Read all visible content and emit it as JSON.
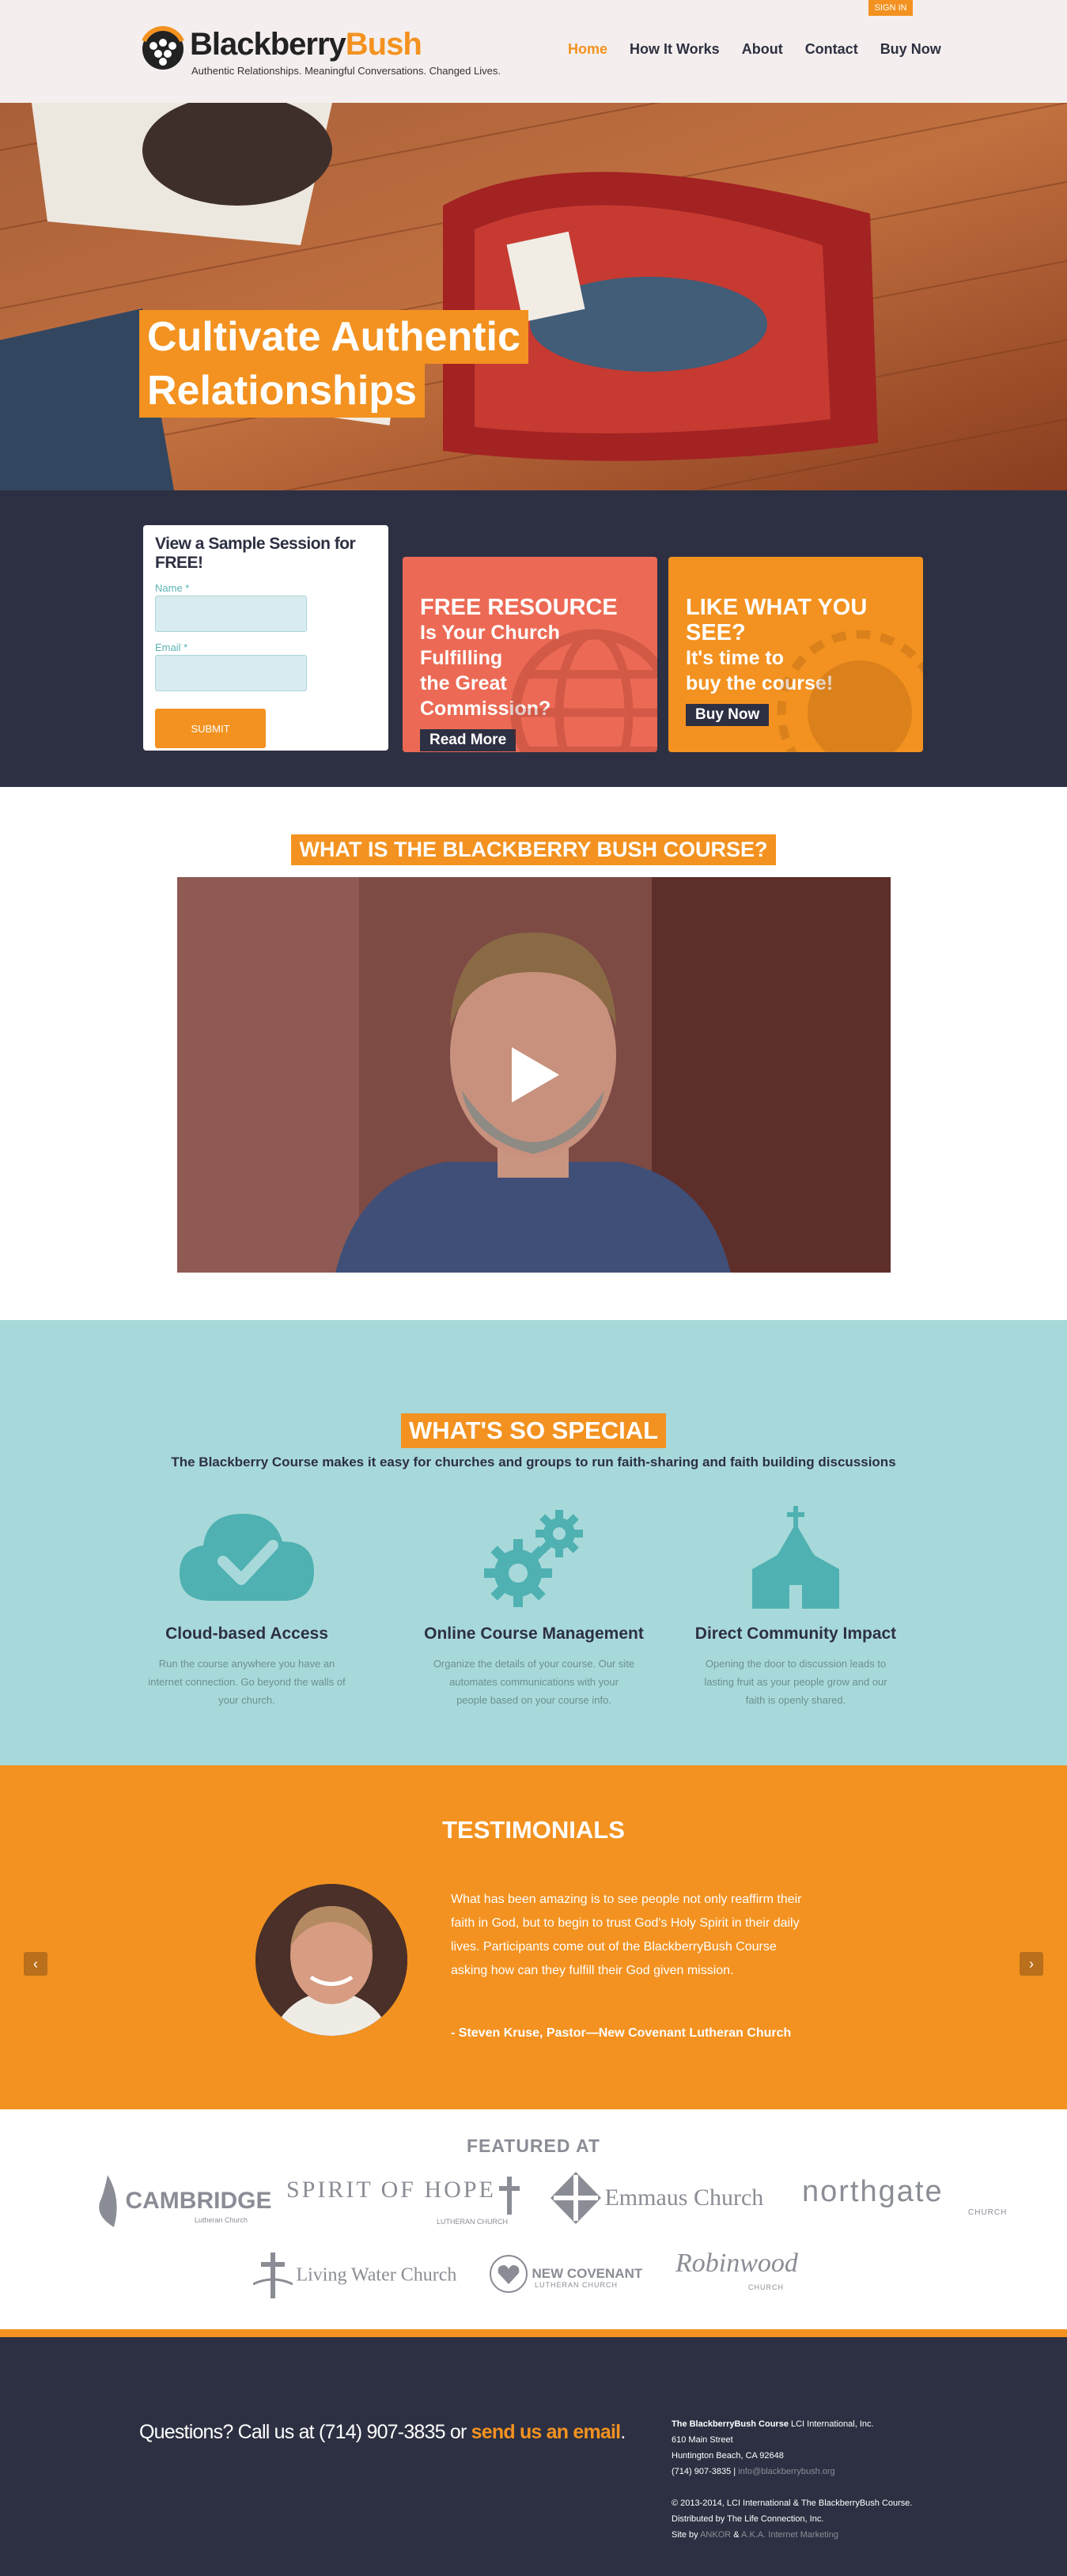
{
  "header": {
    "signin_label": "SIGN IN",
    "brand_part1": "Blackberry",
    "brand_part2": "Bush",
    "tagline": "Authentic Relationships. Meaningful Conversations. Changed Lives.",
    "nav": [
      {
        "label": "Home",
        "active": true
      },
      {
        "label": "How It Works",
        "active": false
      },
      {
        "label": "About",
        "active": false
      },
      {
        "label": "Contact",
        "active": false
      },
      {
        "label": "Buy Now",
        "active": false
      }
    ]
  },
  "hero": {
    "line1": "Cultivate Authentic",
    "line2": "Relationships"
  },
  "signup": {
    "title": "View a Sample Session for FREE!",
    "name_label": "Name *",
    "email_label": "Email *",
    "submit_label": "SUBMIT"
  },
  "promo_resource": {
    "heading": "FREE RESOURCE",
    "line1": "Is Your Church Fulfilling",
    "line2": "the Great Commission?",
    "button": "Read More"
  },
  "promo_buy": {
    "heading": "LIKE WHAT YOU SEE?",
    "line1": "It's time to",
    "line2": "buy the course!",
    "button": "Buy Now"
  },
  "video_section": {
    "title": "WHAT IS THE BLACKBERRY BUSH COURSE?"
  },
  "special": {
    "title": "WHAT'S SO SPECIAL",
    "subtitle": "The Blackberry Course makes it easy for churches and groups to run faith-sharing and faith building discussions",
    "features": [
      {
        "icon": "cloud-check-icon",
        "title": "Cloud-based Access",
        "text": "Run the course anywhere you have an internet connection. Go beyond the walls of your church."
      },
      {
        "icon": "gears-icon",
        "title": "Online Course Management",
        "text": "Organize the details of your course. Our site automates communications with your people based on your course info."
      },
      {
        "icon": "church-icon",
        "title": "Direct Community Impact",
        "text": "Opening the door to discussion leads to lasting fruit as your people grow and our faith is openly shared."
      }
    ]
  },
  "testimonials": {
    "title": "TESTIMONIALS",
    "quote": "What has been amazing is to see people not only reaffirm their faith in God, but to begin to trust God's Holy Spirit in their daily lives.  Participants come out of the BlackberryBush Course asking how can they fulfill their God given mission.",
    "author": "- Steven Kruse, Pastor—New Covenant Lutheran Church"
  },
  "featured": {
    "title": "FEATURED AT",
    "logos": [
      {
        "name": "CAMBRIDGE",
        "sub": "Lutheran Church"
      },
      {
        "name": "SPIRIT OF HOPE",
        "sub": "LUTHERAN CHURCH"
      },
      {
        "name": "Emmaus Church",
        "sub": ""
      },
      {
        "name": "northgate",
        "sub": "CHURCH"
      },
      {
        "name": "Living Water Church",
        "sub": ""
      },
      {
        "name": "NEW COVENANT",
        "sub": "LUTHERAN CHURCH"
      },
      {
        "name": "Robinwood",
        "sub": "CHURCH"
      }
    ]
  },
  "footer": {
    "call_prefix": "Questions? Call us at (714) 907-3835 or ",
    "call_link": "send us an email",
    "call_suffix": ".",
    "company_bold": "The BlackberryBush Course",
    "company_rest": " LCI International, Inc.",
    "address1": "610 Main Street",
    "address2": "Huntington Beach, CA 92648",
    "phone": "(714) 907-3835 | ",
    "email": "info@blackberrybush.org",
    "copyright": "© 2013-2014, LCI International & The BlackberryBush Course.",
    "distributed": "Distributed by The Life Connection, Inc.",
    "site_by_prefix": "Site by ",
    "site_by_a": "ANKOR",
    "site_by_amp": " & ",
    "site_by_b": "A.K.A. Internet Marketing"
  },
  "colors": {
    "accent": "#f39220",
    "navy": "#2d3042",
    "teal_bg": "#a8d9da",
    "teal_icon": "#4fb1b1",
    "coral": "#ec6a55"
  }
}
